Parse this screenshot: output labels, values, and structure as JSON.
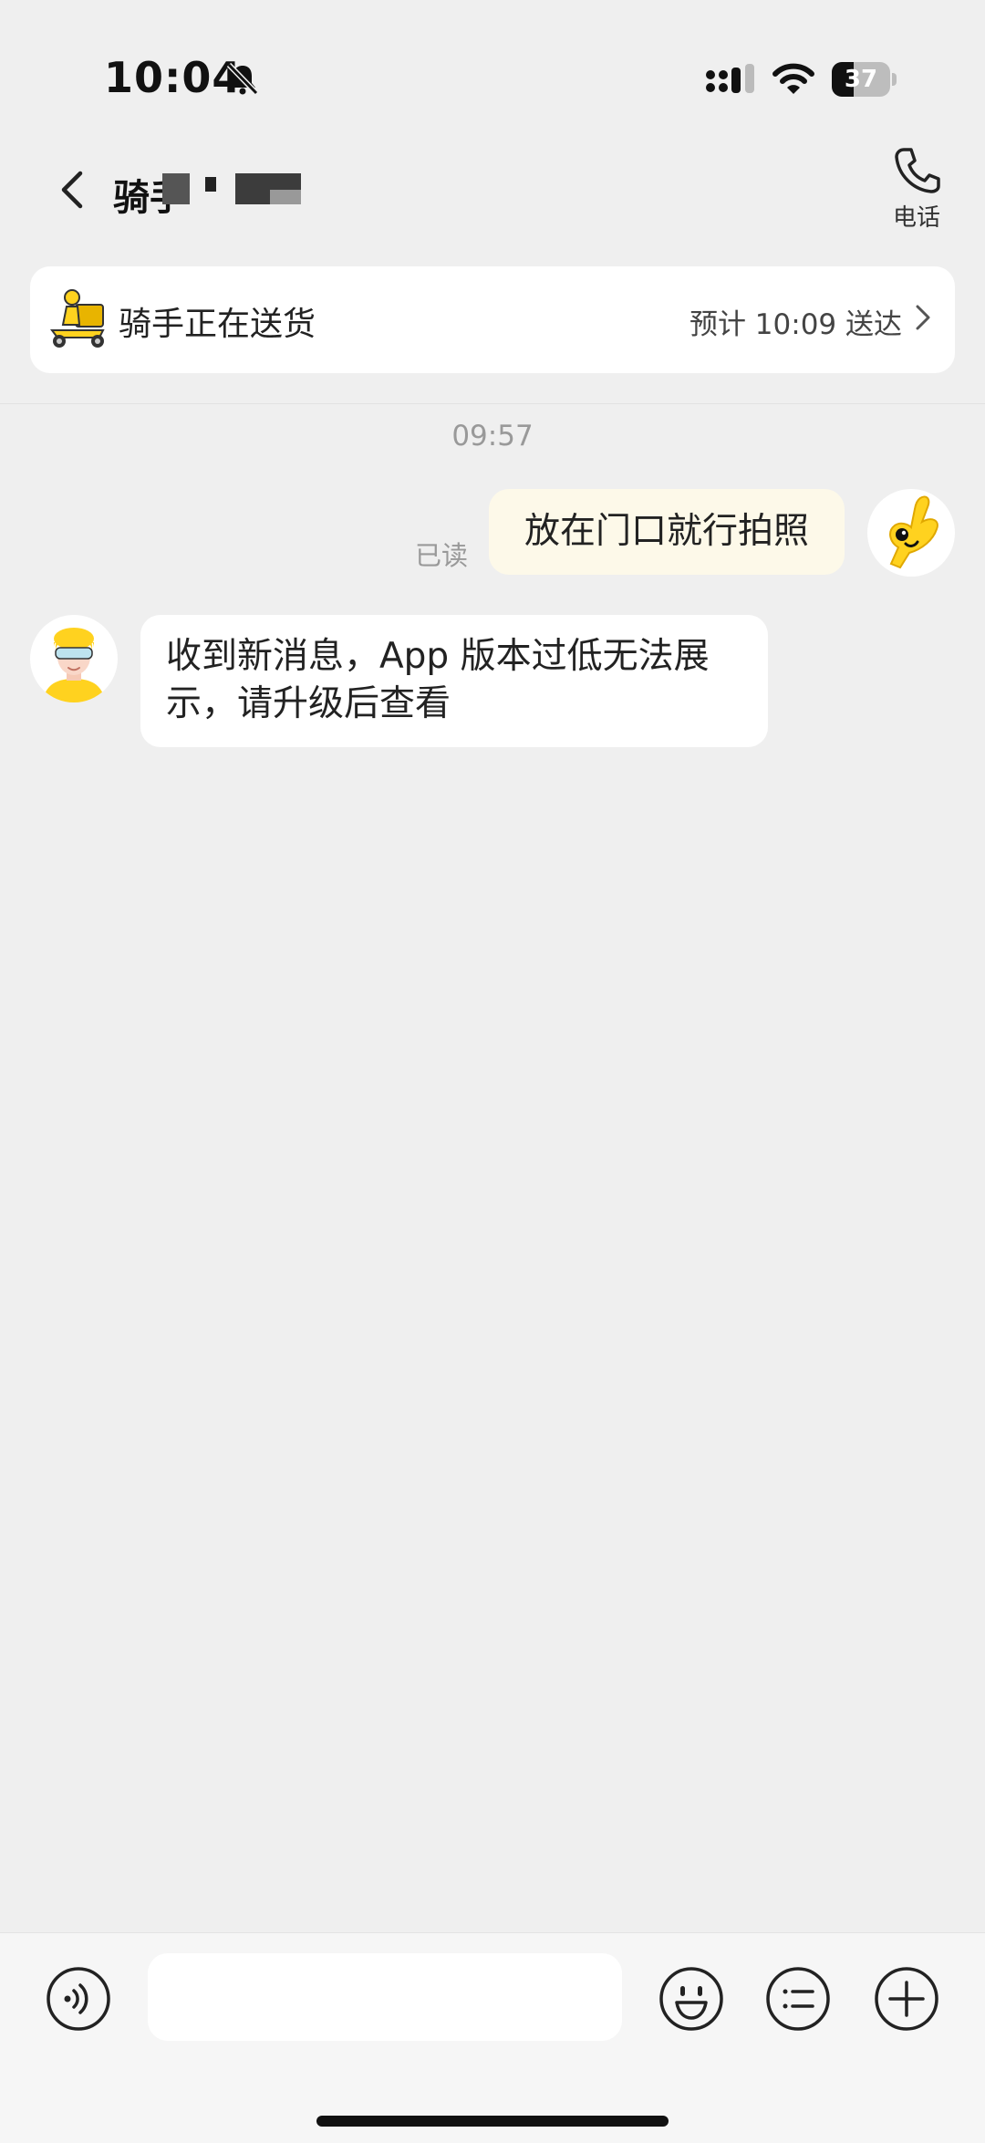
{
  "status_bar": {
    "time": "10:04",
    "battery_percent": "37",
    "battery_level": 0.37
  },
  "header": {
    "title": "骑手",
    "phone_label": "电话"
  },
  "delivery": {
    "status": "骑手正在送货",
    "eta": "预计 10:09 送达"
  },
  "chat": {
    "timestamp": "09:57",
    "outgoing": {
      "read_status": "已读",
      "text": "放在门口就行拍照"
    },
    "incoming": {
      "text": "收到新消息，App 版本过低无法展示，请升级后查看"
    }
  },
  "input": {
    "placeholder": ""
  },
  "colors": {
    "accent_yellow": "#ffd21f",
    "background": "#efefef",
    "outgoing_bubble": "#fdf9e9"
  },
  "icons": [
    "bell-off-icon",
    "signal-icon",
    "wifi-icon",
    "battery-icon",
    "back-icon",
    "phone-icon",
    "scooter-icon",
    "chevron-right-icon",
    "voice-icon",
    "emoji-icon",
    "quick-reply-icon",
    "plus-icon"
  ]
}
